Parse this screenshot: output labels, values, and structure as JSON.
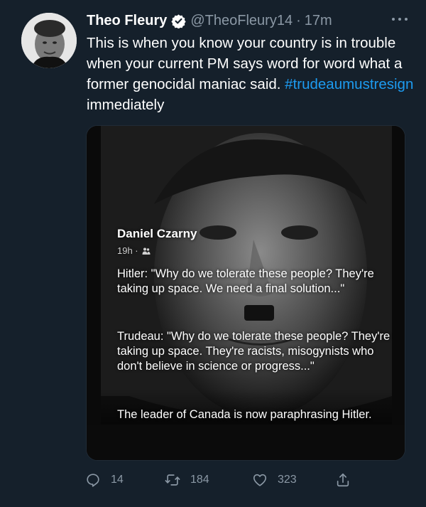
{
  "tweet": {
    "author": {
      "name": "Theo Fleury",
      "handle": "@TheoFleury14",
      "separator": "·",
      "time": "17m",
      "verified": true
    },
    "text": {
      "body": "This is when you know your country is in trouble when your current PM says word for word what a former genocidal maniac said.",
      "hashtag": "#trudeaumustresign",
      "tail": " immediately"
    },
    "media": {
      "poster_name": "Daniel Czarny",
      "poster_meta": "19h ·",
      "quote_1": "Hitler: \"Why do we tolerate these people? They're taking up space. We need a final solution...\"",
      "quote_2": "Trudeau: \"Why do we tolerate these people? They're taking up space. They're racists, misogynists who don't believe in science or progress...\"",
      "quote_3": "The leader of Canada is now paraphrasing Hitler."
    },
    "actions": {
      "reply_count": "14",
      "retweet_count": "184",
      "like_count": "323"
    }
  },
  "icons": [
    "verified-badge-icon",
    "more-options-icon",
    "reply-icon",
    "retweet-icon",
    "like-icon",
    "share-icon",
    "friends-icon"
  ],
  "colors": {
    "background": "#15202b",
    "text_primary": "#ffffff",
    "text_secondary": "#8b98a5",
    "link": "#1d9bf0",
    "verified": "#1d9bf0"
  }
}
